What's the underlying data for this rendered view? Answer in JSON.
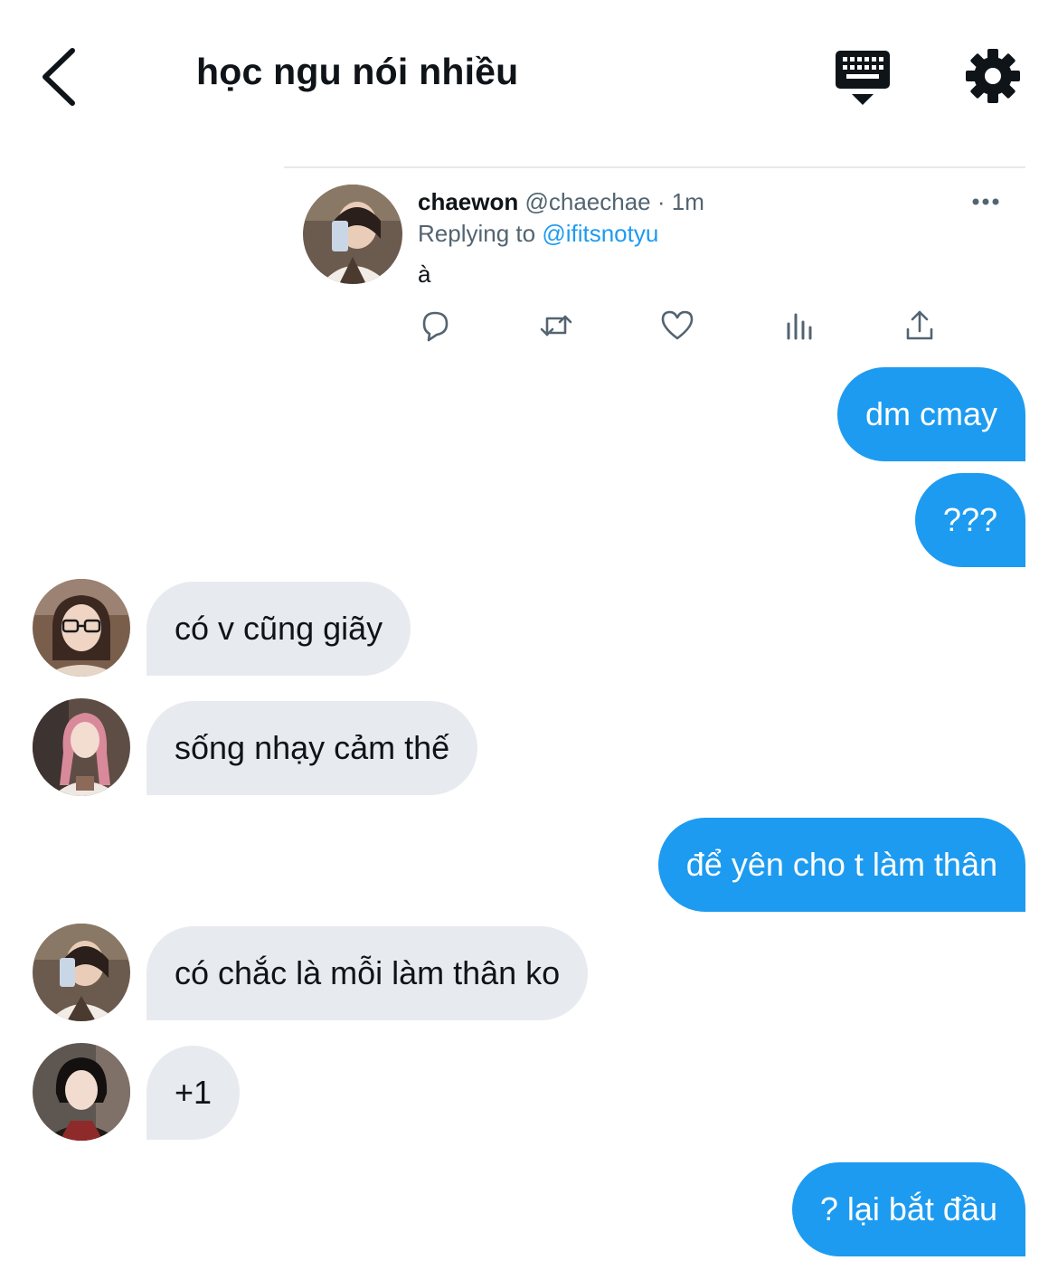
{
  "header": {
    "title": "học ngu nói nhiều",
    "back_icon": "chevron-left-icon",
    "keyboard_icon": "keyboard-icon",
    "settings_icon": "gear-icon"
  },
  "tweet": {
    "name": "chaewon",
    "handle": "@chaechae",
    "separator": " · ",
    "time": "1m",
    "replying_prefix": "Replying to ",
    "replying_to": "@ifitsnotyu",
    "text": "à",
    "actions": [
      "reply-icon",
      "retweet-icon",
      "like-icon",
      "views-icon",
      "share-icon"
    ]
  },
  "messages": [
    {
      "side": "out",
      "text": "dm cmay"
    },
    {
      "side": "out",
      "text": "???"
    },
    {
      "side": "in",
      "text": "có v cũng giãy"
    },
    {
      "side": "in",
      "text": "sống nhạy cảm thế"
    },
    {
      "side": "out",
      "text": "để yên cho t làm thân"
    },
    {
      "side": "in",
      "text": "có chắc là mỗi làm thân ko"
    },
    {
      "side": "in",
      "text": "+1"
    },
    {
      "side": "out",
      "text": "? lại bắt đầu"
    }
  ],
  "colors": {
    "accent": "#1d9bf0",
    "incoming_bubble": "#e7ebef",
    "text": "#0f1419",
    "muted": "#536471"
  }
}
